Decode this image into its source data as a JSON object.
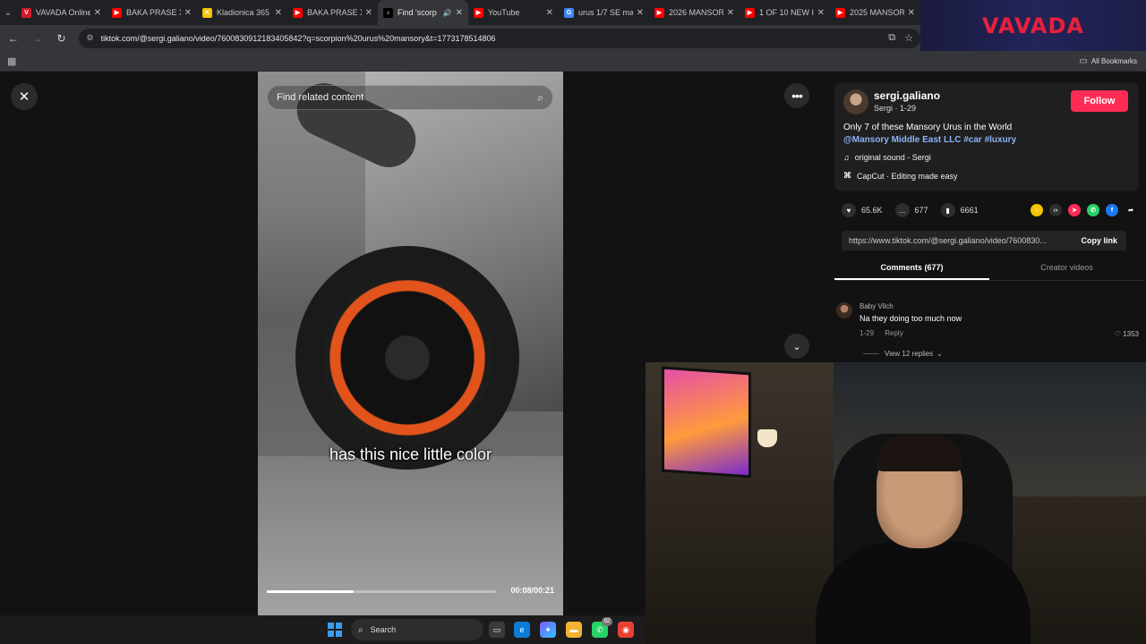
{
  "browser": {
    "tabs": [
      {
        "title": "VAVADA Online",
        "favicon_color": "#d11a2a",
        "favicon_glyph": "V",
        "active": false
      },
      {
        "title": "BAKA PRASE X",
        "favicon_color": "#ff0000",
        "favicon_glyph": "▶",
        "active": false
      },
      {
        "title": "Kladionica 365",
        "favicon_color": "#f5c400",
        "favicon_glyph": "K",
        "active": false
      },
      {
        "title": "BAKA PRASE X",
        "favicon_color": "#ff0000",
        "favicon_glyph": "▶",
        "active": false
      },
      {
        "title": "Find 'scorp",
        "favicon_color": "#000000",
        "favicon_glyph": "♪",
        "active": true
      },
      {
        "title": "YouTube",
        "favicon_color": "#ff0000",
        "favicon_glyph": "▶",
        "active": false
      },
      {
        "title": "urus 1/7 SE ma",
        "favicon_color": "#4285f4",
        "favicon_glyph": "G",
        "active": false
      },
      {
        "title": "2026 MANSOR",
        "favicon_color": "#ff0000",
        "favicon_glyph": "▶",
        "active": false
      },
      {
        "title": "1 OF 10 NEW I",
        "favicon_color": "#ff0000",
        "favicon_glyph": "▶",
        "active": false
      },
      {
        "title": "2025 MANSOR",
        "favicon_color": "#ff0000",
        "favicon_glyph": "▶",
        "active": false
      }
    ],
    "url": "tiktok.com/@sergi.galiano/video/7600830912183405842?q=scorpion%20urus%20mansory&t=1773178514806",
    "all_bookmarks_label": "All Bookmarks"
  },
  "banner": {
    "brand": "VAVADA"
  },
  "video": {
    "search_placeholder": "Find related content",
    "caption": "has this nice little color",
    "time": "00:08/00:21",
    "progress": 0.38
  },
  "author": {
    "name": "sergi.galiano",
    "sub": "Sergi · 1-29",
    "follow_label": "Follow",
    "description": "Only 7 of these Mansory Urus in the World",
    "tags": "@Mansory Middle East LLC #car #luxury",
    "sound": "original sound - Sergi",
    "capcut": "CapCut · Editing made easy"
  },
  "stats": {
    "likes": "65.6K",
    "comments": "677",
    "saves": "6661"
  },
  "share": {
    "link": "https://www.tiktok.com/@sergi.galiano/video/7600830...",
    "copy_label": "Copy link"
  },
  "content_tabs": {
    "comments": "Comments (677)",
    "creator_videos": "Creator videos"
  },
  "comment": {
    "user": "Baby Vilch",
    "text": "Na they doing too much now",
    "date": "1-29",
    "reply_label": "Reply",
    "likes": "1353",
    "view_replies": "View 12 replies"
  },
  "taskbar": {
    "search_label": "Search",
    "whatsapp_badge": "92"
  }
}
